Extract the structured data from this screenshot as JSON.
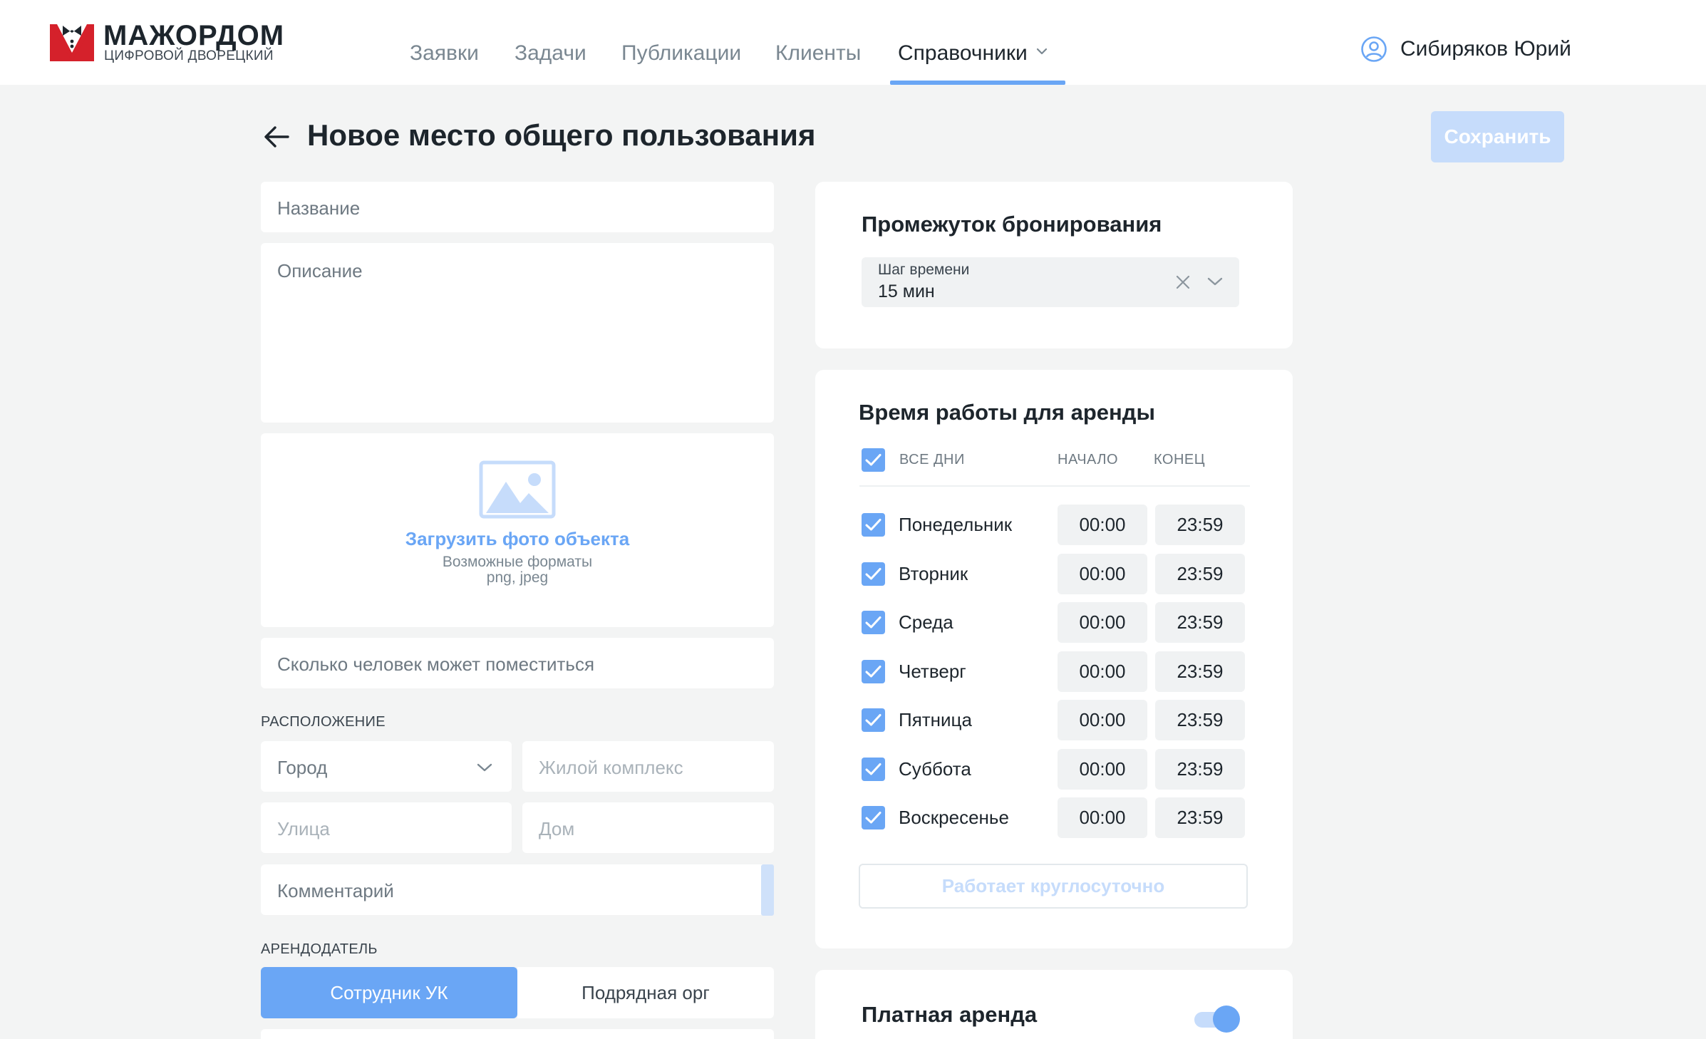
{
  "app": {
    "brand_title": "МАЖОРДОМ",
    "brand_subtitle": "ЦИФРОВОЙ ДВОРЕЦКИЙ",
    "accent_color": "#6aa6f5",
    "brand_color": "#d5212b"
  },
  "header": {
    "nav": [
      {
        "label": "Заявки",
        "active": false
      },
      {
        "label": "Задачи",
        "active": false
      },
      {
        "label": "Публикации",
        "active": false
      },
      {
        "label": "Клиенты",
        "active": false
      },
      {
        "label": "Справочники",
        "active": true,
        "has_dropdown": true
      }
    ],
    "user_name": "Сибиряков Юрий"
  },
  "page": {
    "title": "Новое место общего пользования",
    "save_label": "Сохранить",
    "save_enabled": false
  },
  "form": {
    "name_placeholder": "Название",
    "description_placeholder": "Описание",
    "upload": {
      "link": "Загрузить фото объекта",
      "hint_line1": "Возможные форматы",
      "hint_line2": "png, jpeg"
    },
    "capacity_placeholder": "Сколько человек может поместиться",
    "location_label": "РАСПОЛОЖЕНИЕ",
    "city_placeholder": "Город",
    "complex_placeholder": "Жилой комплекс",
    "street_placeholder": "Улица",
    "house_placeholder": "Дом",
    "comment_placeholder": "Комментарий",
    "landlord_label": "АРЕНДОДАТЕЛЬ",
    "landlord_options": [
      "Сотрудник УК",
      "Подрядная орг"
    ],
    "landlord_selected": "Сотрудник УК"
  },
  "booking": {
    "title": "Промежуток бронирования",
    "step_label": "Шаг времени",
    "step_value": "15 мин"
  },
  "schedule": {
    "title": "Время работы для аренды",
    "all_days_label": "ВСЕ ДНИ",
    "all_days_checked": true,
    "start_header": "НАЧАЛО",
    "end_header": "КОНЕЦ",
    "days": [
      {
        "label": "Понедельник",
        "checked": true,
        "start": "00:00",
        "end": "23:59"
      },
      {
        "label": "Вторник",
        "checked": true,
        "start": "00:00",
        "end": "23:59"
      },
      {
        "label": "Среда",
        "checked": true,
        "start": "00:00",
        "end": "23:59"
      },
      {
        "label": "Четверг",
        "checked": true,
        "start": "00:00",
        "end": "23:59"
      },
      {
        "label": "Пятница",
        "checked": true,
        "start": "00:00",
        "end": "23:59"
      },
      {
        "label": "Суббота",
        "checked": true,
        "start": "00:00",
        "end": "23:59"
      },
      {
        "label": "Воскресенье",
        "checked": true,
        "start": "00:00",
        "end": "23:59"
      }
    ],
    "around_clock_label": "Работает круглосуточно"
  },
  "paid": {
    "title": "Платная аренда",
    "enabled": true
  }
}
